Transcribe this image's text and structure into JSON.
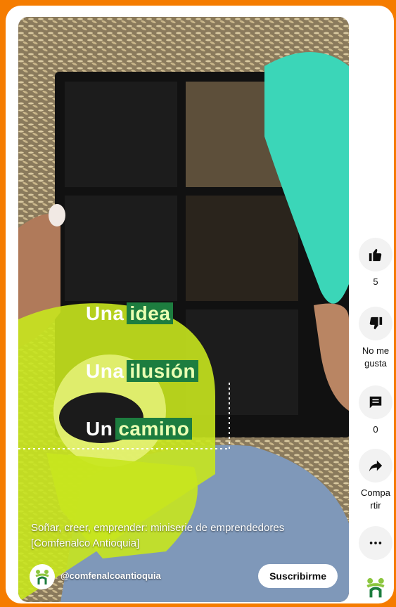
{
  "video": {
    "overlay": [
      {
        "plain": "Una",
        "highlight": "idea"
      },
      {
        "plain": "Una",
        "highlight": "ilusión"
      },
      {
        "plain": "Un",
        "highlight": "camino"
      }
    ],
    "caption": "Soñar, creer, emprender: miniserie de emprendedores [Comfenalco Antioquia]",
    "channel": "@comfenalcoantioquia",
    "subscribe_label": "Suscribirme"
  },
  "actions": {
    "like_count": "5",
    "dislike_label_1": "No me",
    "dislike_label_2": "gusta",
    "comment_count": "0",
    "share_label_1": "Compa",
    "share_label_2": "rtir"
  },
  "colors": {
    "page_border": "#f57c00",
    "brand_green": "#1d7d3f",
    "brand_lime": "#c8e61e"
  },
  "icons": [
    "thumb-up-icon",
    "thumb-down-icon",
    "comment-icon",
    "share-icon",
    "more-icon",
    "comfenalco-logo"
  ]
}
